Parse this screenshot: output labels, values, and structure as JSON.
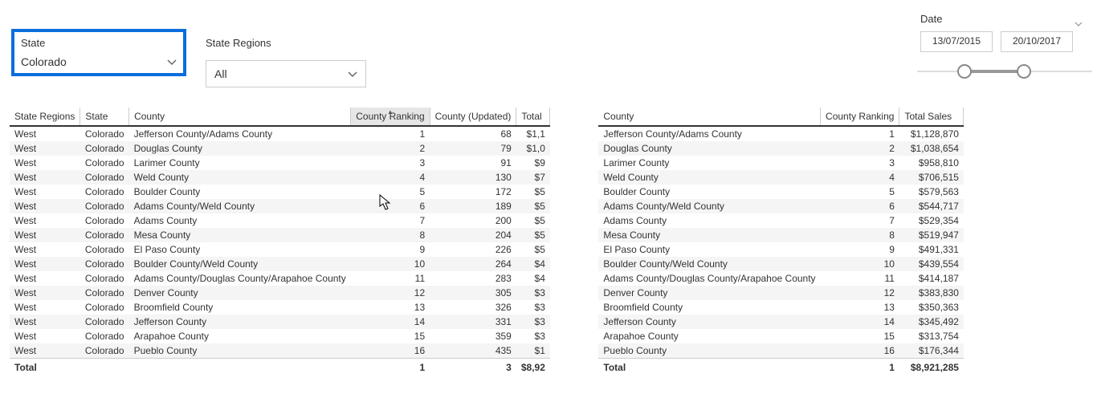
{
  "slicers": {
    "state": {
      "label": "State",
      "value": "Colorado"
    },
    "state_regions": {
      "label": "State Regions",
      "value": "All"
    }
  },
  "date": {
    "label": "Date",
    "from": "13/07/2015",
    "to": "20/10/2017"
  },
  "table1": {
    "headers": {
      "state_regions": "State Regions",
      "state": "State",
      "county": "County",
      "county_ranking": "County Ranking",
      "county_updated": "County (Updated)",
      "total": "Total"
    },
    "rows": [
      {
        "sr": "West",
        "st": "Colorado",
        "co": "Jefferson County/Adams County",
        "cr": "1",
        "cu": "68",
        "tot": "$1,1"
      },
      {
        "sr": "West",
        "st": "Colorado",
        "co": "Douglas County",
        "cr": "2",
        "cu": "79",
        "tot": "$1,0"
      },
      {
        "sr": "West",
        "st": "Colorado",
        "co": "Larimer County",
        "cr": "3",
        "cu": "91",
        "tot": "$9"
      },
      {
        "sr": "West",
        "st": "Colorado",
        "co": "Weld County",
        "cr": "4",
        "cu": "130",
        "tot": "$7"
      },
      {
        "sr": "West",
        "st": "Colorado",
        "co": "Boulder County",
        "cr": "5",
        "cu": "172",
        "tot": "$5"
      },
      {
        "sr": "West",
        "st": "Colorado",
        "co": "Adams County/Weld County",
        "cr": "6",
        "cu": "189",
        "tot": "$5"
      },
      {
        "sr": "West",
        "st": "Colorado",
        "co": "Adams County",
        "cr": "7",
        "cu": "200",
        "tot": "$5"
      },
      {
        "sr": "West",
        "st": "Colorado",
        "co": "Mesa County",
        "cr": "8",
        "cu": "204",
        "tot": "$5"
      },
      {
        "sr": "West",
        "st": "Colorado",
        "co": "El Paso County",
        "cr": "9",
        "cu": "226",
        "tot": "$5"
      },
      {
        "sr": "West",
        "st": "Colorado",
        "co": "Boulder County/Weld County",
        "cr": "10",
        "cu": "264",
        "tot": "$4"
      },
      {
        "sr": "West",
        "st": "Colorado",
        "co": "Adams County/Douglas County/Arapahoe County",
        "cr": "11",
        "cu": "283",
        "tot": "$4"
      },
      {
        "sr": "West",
        "st": "Colorado",
        "co": "Denver County",
        "cr": "12",
        "cu": "305",
        "tot": "$3"
      },
      {
        "sr": "West",
        "st": "Colorado",
        "co": "Broomfield County",
        "cr": "13",
        "cu": "326",
        "tot": "$3"
      },
      {
        "sr": "West",
        "st": "Colorado",
        "co": "Jefferson County",
        "cr": "14",
        "cu": "331",
        "tot": "$3"
      },
      {
        "sr": "West",
        "st": "Colorado",
        "co": "Arapahoe County",
        "cr": "15",
        "cu": "359",
        "tot": "$3"
      },
      {
        "sr": "West",
        "st": "Colorado",
        "co": "Pueblo County",
        "cr": "16",
        "cu": "435",
        "tot": "$1"
      }
    ],
    "footer": {
      "label": "Total",
      "cr": "1",
      "cu": "3",
      "tot": "$8,92"
    }
  },
  "table2": {
    "headers": {
      "county": "County",
      "county_ranking": "County Ranking",
      "total_sales": "Total Sales"
    },
    "rows": [
      {
        "co": "Jefferson County/Adams County",
        "cr": "1",
        "ts": "$1,128,870"
      },
      {
        "co": "Douglas County",
        "cr": "2",
        "ts": "$1,038,654"
      },
      {
        "co": "Larimer County",
        "cr": "3",
        "ts": "$958,810"
      },
      {
        "co": "Weld County",
        "cr": "4",
        "ts": "$706,515"
      },
      {
        "co": "Boulder County",
        "cr": "5",
        "ts": "$579,563"
      },
      {
        "co": "Adams County/Weld County",
        "cr": "6",
        "ts": "$544,717"
      },
      {
        "co": "Adams County",
        "cr": "7",
        "ts": "$529,354"
      },
      {
        "co": "Mesa County",
        "cr": "8",
        "ts": "$519,947"
      },
      {
        "co": "El Paso County",
        "cr": "9",
        "ts": "$491,331"
      },
      {
        "co": "Boulder County/Weld County",
        "cr": "10",
        "ts": "$439,554"
      },
      {
        "co": "Adams County/Douglas County/Arapahoe County",
        "cr": "11",
        "ts": "$414,187"
      },
      {
        "co": "Denver County",
        "cr": "12",
        "ts": "$383,830"
      },
      {
        "co": "Broomfield County",
        "cr": "13",
        "ts": "$350,363"
      },
      {
        "co": "Jefferson County",
        "cr": "14",
        "ts": "$345,492"
      },
      {
        "co": "Arapahoe County",
        "cr": "15",
        "ts": "$313,754"
      },
      {
        "co": "Pueblo County",
        "cr": "16",
        "ts": "$176,344"
      }
    ],
    "footer": {
      "label": "Total",
      "cr": "1",
      "ts": "$8,921,285"
    }
  }
}
